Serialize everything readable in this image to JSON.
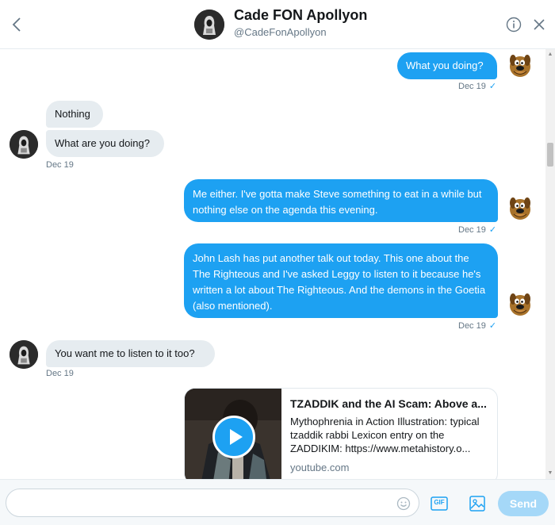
{
  "header": {
    "name": "Cade FON Apollyon",
    "handle": "@CadeFonApollyon",
    "back_icon": "chevron-left-icon",
    "info_icon": "info-circle-icon",
    "close_icon": "close-icon"
  },
  "messages": [
    {
      "from": "me",
      "text": "What you doing?",
      "meta": "Dec 19"
    },
    {
      "from": "them",
      "text": "Nothing"
    },
    {
      "from": "them",
      "text": "What are you doing?",
      "meta": "Dec 19"
    },
    {
      "from": "me",
      "text": "Me either. I've gotta make Steve something to eat in a while but nothing else on the agenda this evening.",
      "meta": "Dec 19"
    },
    {
      "from": "me",
      "text": "John Lash has put another talk out today. This one about the The Righteous and I've asked Leggy to listen to it because he's written a lot about The Righteous. And the demons in the Goetia (also mentioned).",
      "meta": "Dec 19"
    },
    {
      "from": "them",
      "text": "You want me to listen to it too?",
      "meta": "Dec 19"
    }
  ],
  "link_card": {
    "title": "TZADDIK and the AI Scam: Above a...",
    "description": "Mythophrenia in Action Illustration: typical tzaddik rabbi Lexicon entry on the ZADDIKIM: https://www.metahistory.o...",
    "domain": "youtube.com"
  },
  "composer": {
    "placeholder": "",
    "value": "",
    "gif_label": "GIF",
    "send_label": "Send"
  },
  "colors": {
    "sent_bubble": "#1da1f2",
    "received_bubble": "#e6ecf0",
    "accent": "#1da1f2",
    "send_disabled": "#a5d8f8"
  }
}
